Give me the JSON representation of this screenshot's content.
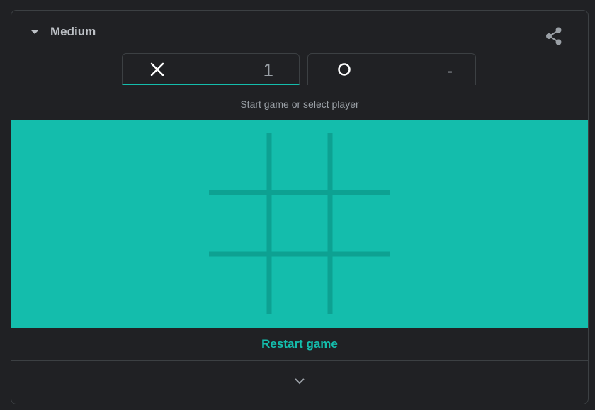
{
  "header": {
    "difficulty_label": "Medium",
    "difficulty_icon": "caret-down-icon",
    "share_icon": "share-icon"
  },
  "players": [
    {
      "mark": "X",
      "mark_icon": "x-mark-icon",
      "score": "1",
      "active": true
    },
    {
      "mark": "O",
      "mark_icon": "o-mark-icon",
      "score": "-",
      "active": false
    }
  ],
  "status": "Start game or select player",
  "board": {
    "cells": [
      "",
      "",
      "",
      "",
      "",
      "",
      "",
      "",
      ""
    ],
    "background_color": "#14bdac",
    "grid_line_color": "#0da192"
  },
  "restart_label": "Restart game",
  "expand_icon": "chevron-down-icon",
  "colors": {
    "accent": "#14bdac",
    "background": "#202124",
    "border": "#3c4043",
    "text_muted": "#9aa0a6"
  }
}
